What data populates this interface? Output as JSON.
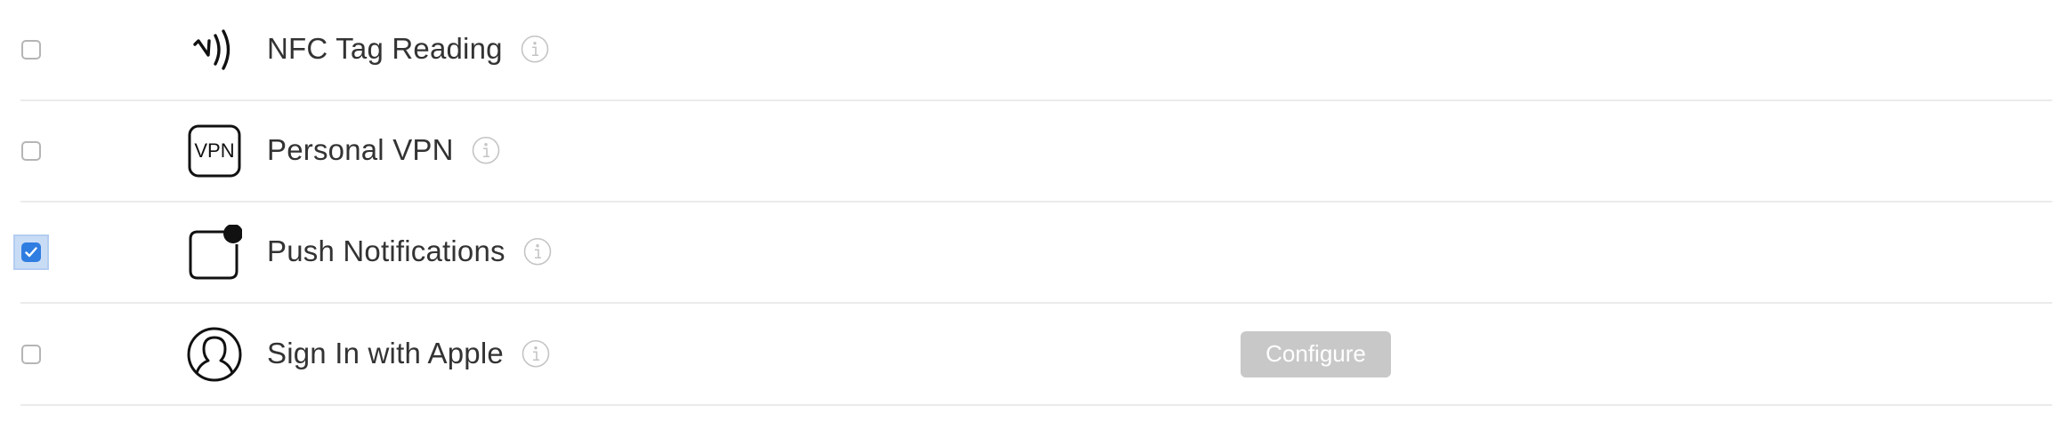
{
  "capabilities": [
    {
      "label": "NFC Tag Reading",
      "icon": "nfc-icon",
      "checked": false
    },
    {
      "label": "Personal VPN",
      "icon": "vpn-icon",
      "icon_text": "VPN",
      "checked": false
    },
    {
      "label": "Push Notifications",
      "icon": "push-notification-icon",
      "checked": true
    },
    {
      "label": "Sign In with Apple",
      "icon": "person-circle-icon",
      "checked": false,
      "action_label": "Configure"
    }
  ],
  "colors": {
    "checkbox_checked": "#2f7de1",
    "focus_ring": "#c9dcf5",
    "configure_disabled_bg": "#c8c8c8",
    "divider": "#ebebeb"
  }
}
